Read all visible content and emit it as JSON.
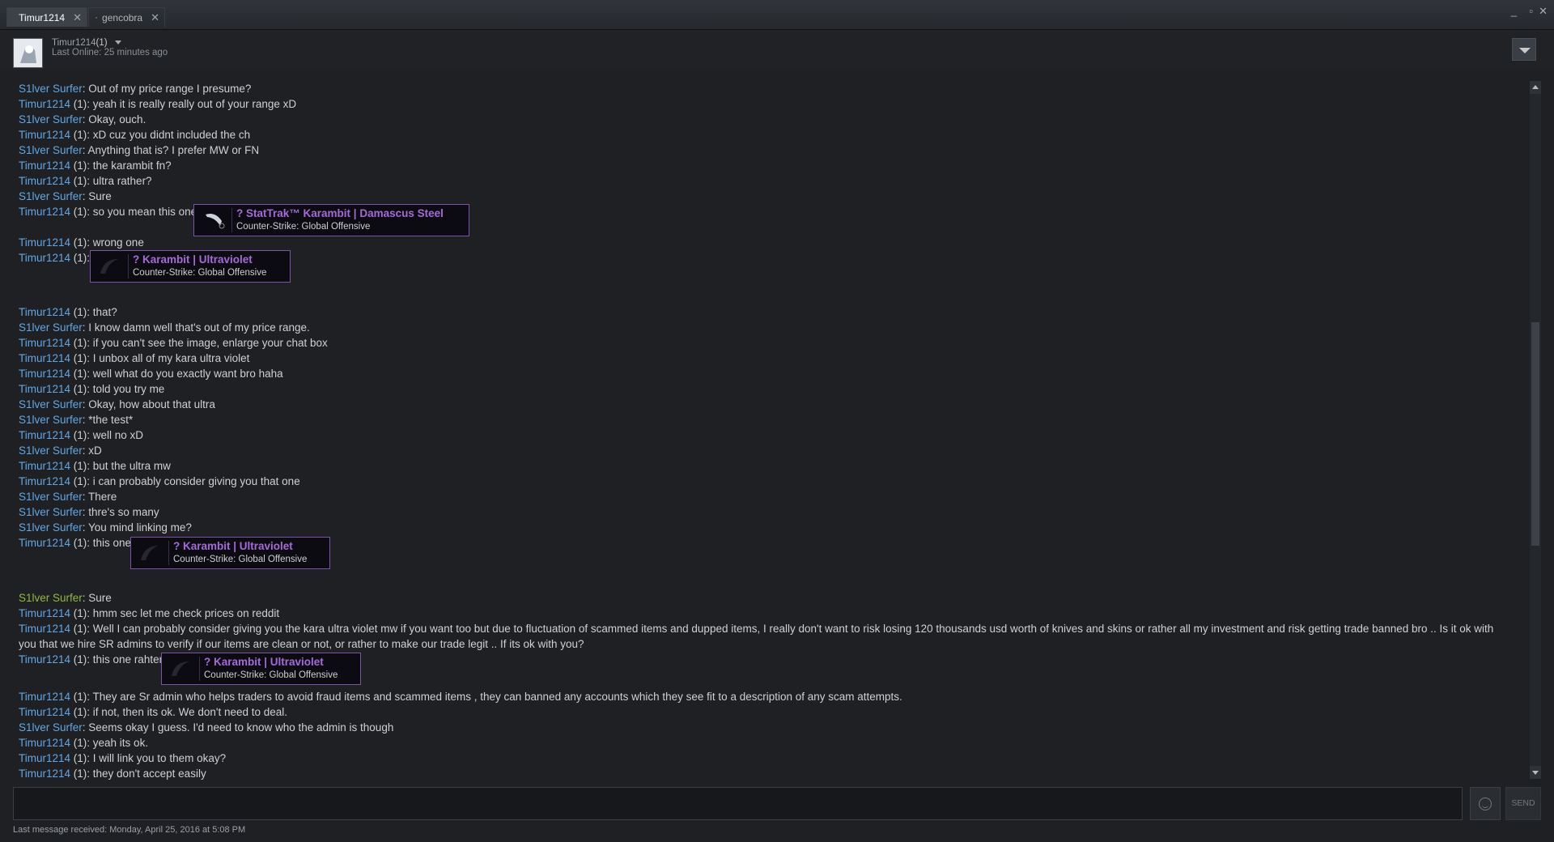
{
  "tabs": [
    {
      "label": "Timur1214",
      "active": true
    },
    {
      "label": "gencobra",
      "active": false
    }
  ],
  "window": {
    "minimize": "_",
    "maximize": "▫",
    "close": "✕"
  },
  "header": {
    "name": "Timur1214",
    "count": "(1)",
    "last_online": "Last Online: 25 minutes ago"
  },
  "messages": [
    {
      "speaker": "S1lver Surfer",
      "text": ": Out of my price range I presume?"
    },
    {
      "speaker": "Timur1214",
      "tag": " (1)",
      "text": ": yeah it is really really out of your range xD"
    },
    {
      "speaker": "S1lver Surfer",
      "text": ": Okay, ouch."
    },
    {
      "speaker": "Timur1214",
      "tag": " (1)",
      "text": ": xD cuz you didnt included the ch"
    },
    {
      "speaker": "S1lver Surfer",
      "text": ": Anything that is? I prefer MW or FN"
    },
    {
      "speaker": "Timur1214",
      "tag": " (1)",
      "text": ": the karambit fn?"
    },
    {
      "speaker": "Timur1214",
      "tag": " (1)",
      "text": ": ultra rather?"
    },
    {
      "speaker": "S1lver Surfer",
      "text": ": Sure"
    },
    {
      "speaker": "Timur1214",
      "tag": " (1)",
      "text": ": so you mean this one"
    },
    {
      "speaker": "Timur1214",
      "tag": " (1)",
      "text": ": wrong one"
    },
    {
      "speaker": "Timur1214",
      "tag": " (1)",
      "text": ":"
    },
    {
      "speaker": "Timur1214",
      "tag": " (1)",
      "text": ": that?"
    },
    {
      "speaker": "S1lver Surfer",
      "text": ": I know damn well that's out of my price range."
    },
    {
      "speaker": "Timur1214",
      "tag": " (1)",
      "text": ": if you can't see the image, enlarge your chat box"
    },
    {
      "speaker": "Timur1214",
      "tag": " (1)",
      "text": ": I unbox all of my kara ultra violet"
    },
    {
      "speaker": "Timur1214",
      "tag": " (1)",
      "text": ": well what do you exactly want bro haha"
    },
    {
      "speaker": "Timur1214",
      "tag": " (1)",
      "text": ": told you try me"
    },
    {
      "speaker": "S1lver Surfer",
      "text": ": Okay, how about that ultra"
    },
    {
      "speaker": "S1lver Surfer",
      "text": ": *the test*"
    },
    {
      "speaker": "Timur1214",
      "tag": " (1)",
      "text": ": well no xD"
    },
    {
      "speaker": "S1lver Surfer",
      "text": ": xD"
    },
    {
      "speaker": "Timur1214",
      "tag": " (1)",
      "text": ": but the ultra mw"
    },
    {
      "speaker": "Timur1214",
      "tag": " (1)",
      "text": ": i can probably consider giving you that one"
    },
    {
      "speaker": "S1lver Surfer",
      "text": ": There"
    },
    {
      "speaker": "S1lver Surfer",
      "text": ": thre's so many"
    },
    {
      "speaker": "S1lver Surfer",
      "text": ": You mind linking me?"
    },
    {
      "speaker": "Timur1214",
      "tag": " (1)",
      "text": ": this one"
    },
    {
      "speaker": "S1lver Surfer",
      "text": ": Sure",
      "green": true
    },
    {
      "speaker": "Timur1214",
      "tag": " (1)",
      "text": ": hmm sec let me check prices on reddit"
    },
    {
      "speaker": "Timur1214",
      "tag": " (1)",
      "text": ": Well I can probably consider giving you the kara ultra violet mw if you want too but due to fluctuation of scammed items and dupped items, I really don't want to risk losing 120 thousands usd worth of knives and skins or rather all my investment and risk getting trade banned bro .. Is it ok with you that we hire SR admins to verify if our items are clean or not, or rather to make our trade legit .. If its ok with you?"
    },
    {
      "speaker": "Timur1214",
      "tag": " (1)",
      "text": ": this one rahter"
    },
    {
      "speaker": "Timur1214",
      "tag": " (1)",
      "text": ": They are Sr admin who helps traders to avoid fraud items and scammed items , they can banned any accounts which they see fit to a description of any scam attempts."
    },
    {
      "speaker": "Timur1214",
      "tag": " (1)",
      "text": ": if not, then its ok. We don't need to deal."
    },
    {
      "speaker": "S1lver Surfer",
      "text": ": Seems okay I guess. I'd need to know who the admin is though"
    },
    {
      "speaker": "Timur1214",
      "tag": " (1)",
      "text": ": yeah its ok."
    },
    {
      "speaker": "Timur1214",
      "tag": " (1)",
      "text": ": I will link you to them okay?"
    },
    {
      "speaker": "Timur1214",
      "tag": " (1)",
      "text": ": they don't accept easily"
    }
  ],
  "cards": [
    {
      "title": "? StatTrak™ Karambit | Damascus Steel",
      "game": "Counter-Strike: Global Offensive"
    },
    {
      "title": "? Karambit | Ultraviolet",
      "game": "Counter-Strike: Global Offensive"
    },
    {
      "title": "? Karambit | Ultraviolet",
      "game": "Counter-Strike: Global Offensive"
    },
    {
      "title": "? Karambit | Ultraviolet",
      "game": "Counter-Strike: Global Offensive"
    }
  ],
  "composer": {
    "send_label": "SEND"
  },
  "footer": {
    "status": "Last message received: Monday, April 25, 2016 at 5:08 PM"
  }
}
